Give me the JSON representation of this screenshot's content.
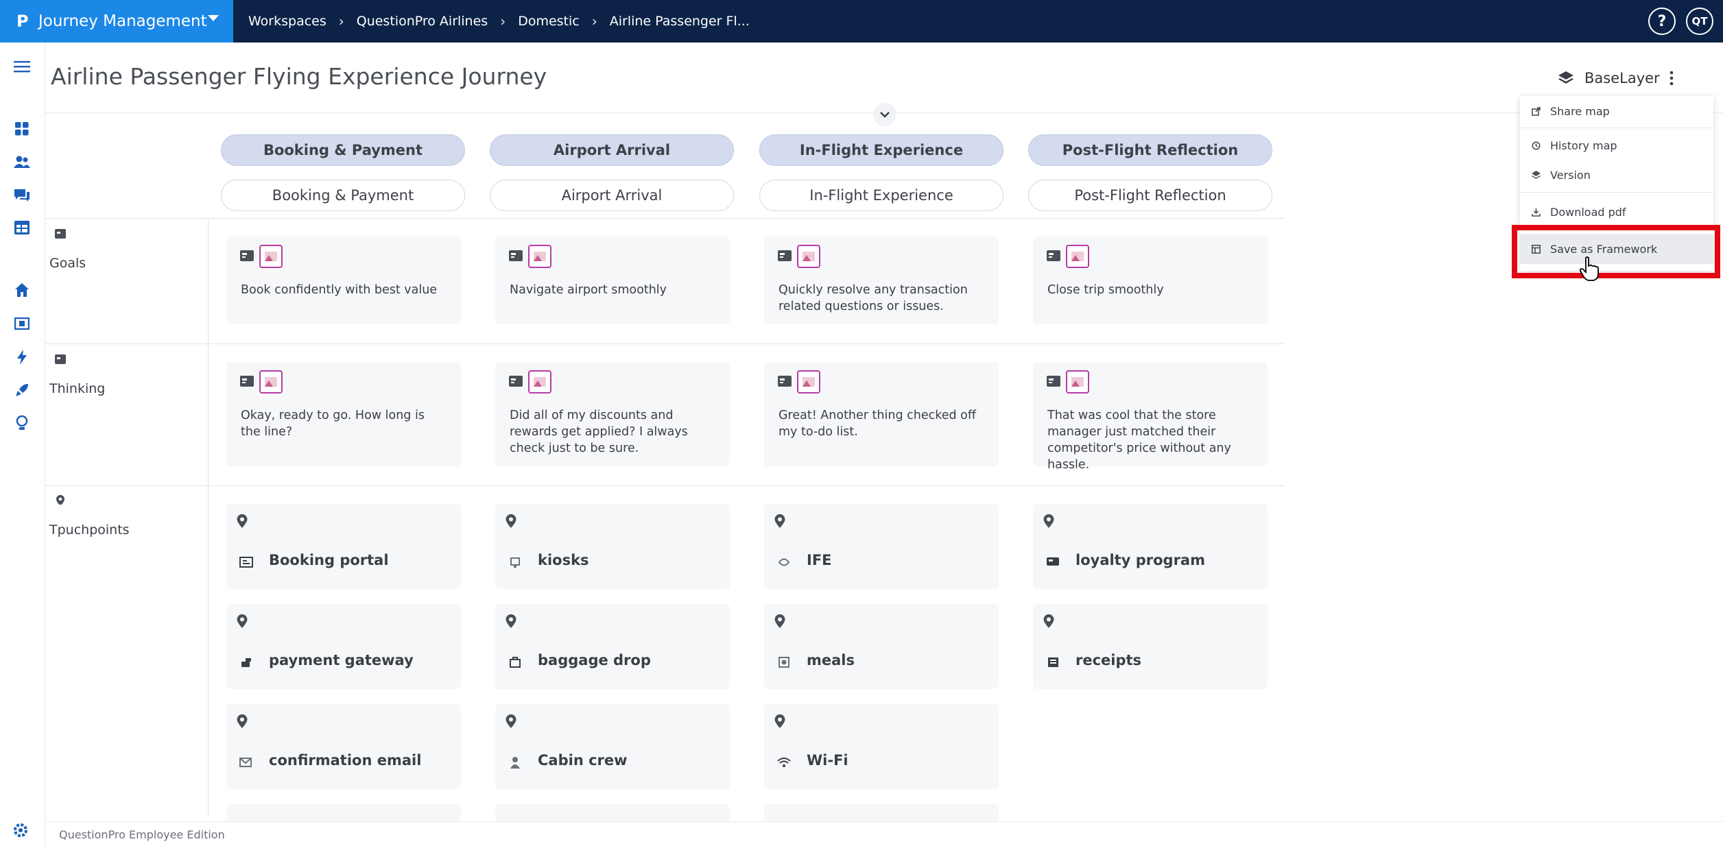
{
  "app": {
    "name": "Journey Management",
    "logo": "P"
  },
  "breadcrumb": [
    "Workspaces",
    "QuestionPro Airlines",
    "Domestic",
    "Airline Passenger Fl..."
  ],
  "topbar": {
    "help": "?",
    "avatar": "QT"
  },
  "page": {
    "title": "Airline Passenger Flying Experience Journey"
  },
  "layer": {
    "label": "BaseLayer"
  },
  "menu": {
    "items": [
      {
        "label": "Share map",
        "icon": "share-icon"
      },
      {
        "label": "History map",
        "icon": "history-icon"
      },
      {
        "label": "Version",
        "icon": "layers-icon"
      },
      {
        "label": "Download pdf",
        "icon": "download-icon"
      },
      {
        "label": "Save as Framework",
        "icon": "framework-icon"
      }
    ]
  },
  "stages": [
    "Booking & Payment",
    "Airport Arrival",
    "In-Flight Experience",
    "Post-Flight Reflection"
  ],
  "substages": [
    "Booking & Payment",
    "Airport Arrival",
    "In-Flight Experience",
    "Post-Flight Reflection"
  ],
  "rows": {
    "goals": {
      "label": "Goals",
      "cards": [
        "Book confidently with best value",
        "Navigate airport smoothly",
        "Quickly resolve any transaction related questions or issues.",
        "Close trip smoothly"
      ]
    },
    "thinking": {
      "label": "Thinking",
      "cards": [
        "Okay, ready to go. How long is the line?",
        "Did all of my discounts and rewards get applied? I always check just to be sure.",
        "Great! Another thing checked off my to-do list.",
        "That was cool that the store manager just matched their competitor's price without any hassle."
      ]
    },
    "touchpoints": {
      "label": "Tpuchpoints",
      "items": [
        [
          "Booking portal",
          "kiosks",
          "IFE",
          "loyalty program"
        ],
        [
          "payment gateway",
          "baggage drop",
          "meals",
          "receipts"
        ],
        [
          "confirmation email",
          "Cabin crew",
          "Wi-Fi"
        ]
      ]
    }
  },
  "footer": {
    "text": "QuestionPro Employee Edition"
  },
  "colors": {
    "topbar": "#0c2347",
    "accent": "#1b87e6",
    "stage_pill": "#d4dbef",
    "card": "#f6f7f9",
    "highlight": "#e30613"
  }
}
